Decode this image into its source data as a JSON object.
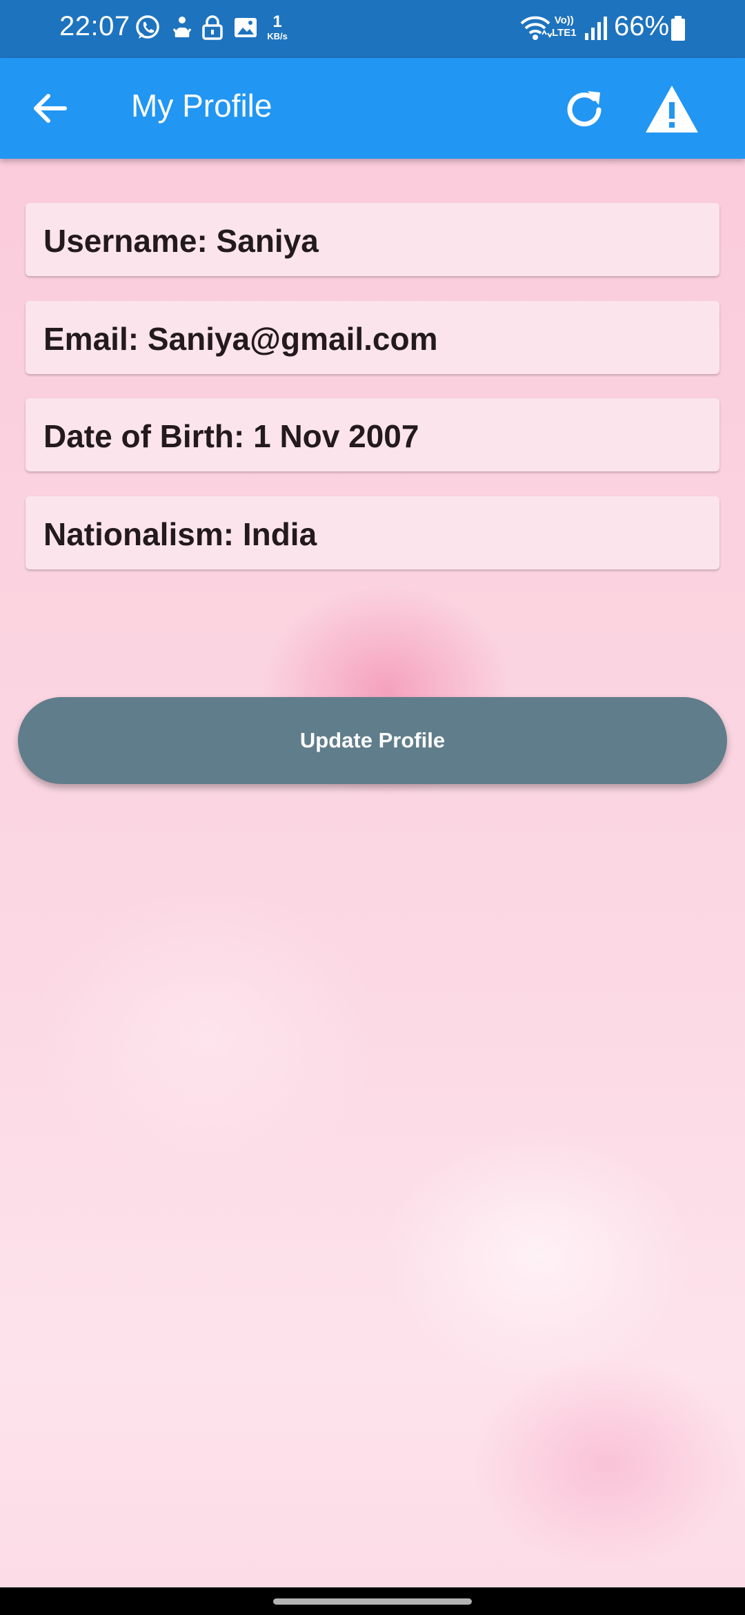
{
  "status_bar": {
    "time": "22:07",
    "net_speed_value": "1",
    "net_speed_unit": "KB/s",
    "volte_label_top": "Vo))",
    "volte_label_bottom": "LTE1",
    "battery_percent": "66%",
    "icons": [
      "whatsapp-icon",
      "notification-app-icon",
      "lock-icon",
      "gallery-icon",
      "wifi-icon",
      "signal-icon",
      "battery-icon"
    ]
  },
  "app_bar": {
    "title": "My Profile",
    "background": "#2196f3",
    "icons": [
      "back-arrow-icon",
      "refresh-icon",
      "warning-icon"
    ]
  },
  "profile": {
    "username": "Username: Saniya",
    "email": "Email: Saniya@gmail.com",
    "dob": "Date of Birth: 1 Nov 2007",
    "nationality": "Nationalism: India"
  },
  "actions": {
    "update_label": "Update Profile",
    "update_color": "#607d8b"
  },
  "colors": {
    "status_bar": "#1e73be",
    "card_background": "#fce4ec",
    "text": "#231a1d"
  }
}
